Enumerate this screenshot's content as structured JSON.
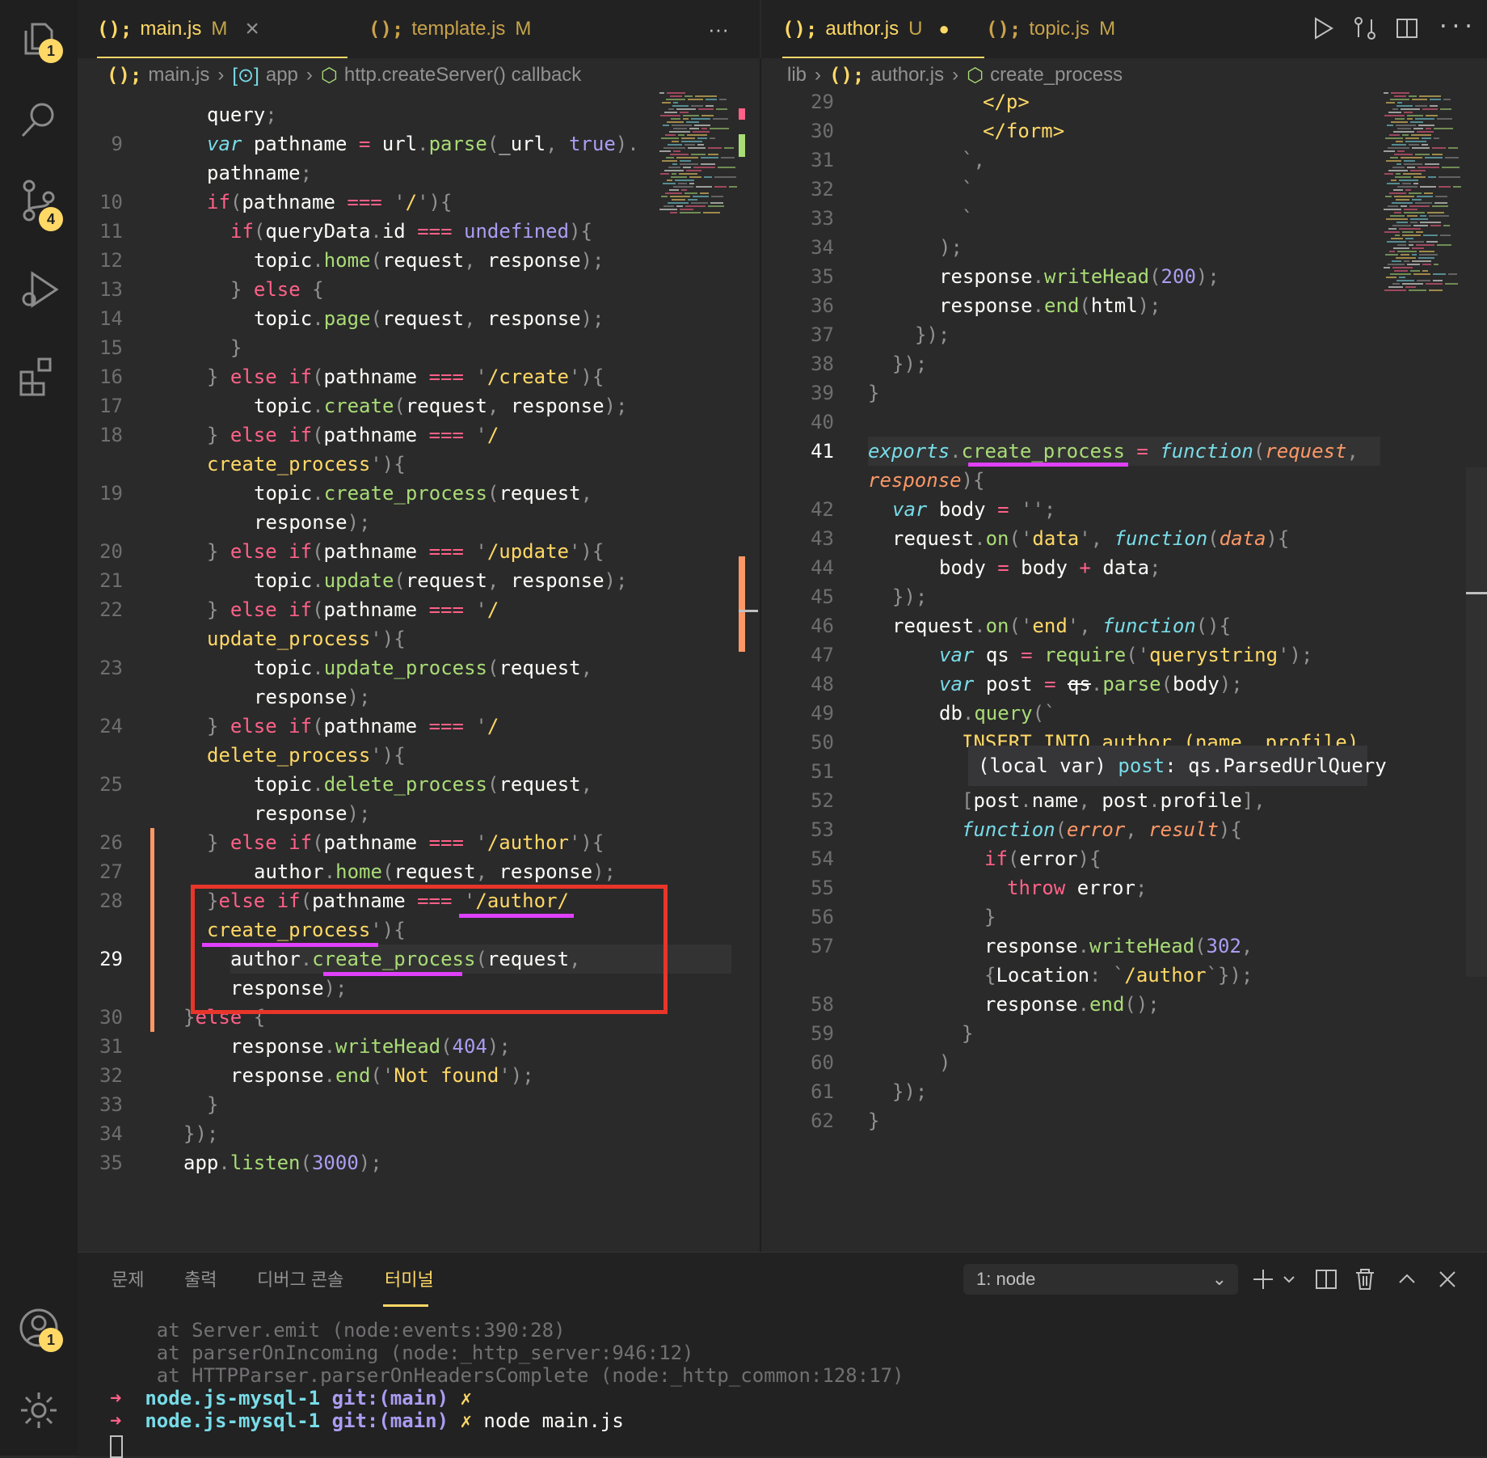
{
  "activity_bar": {
    "explorer_badge": "1",
    "scm_badge": "4",
    "account_badge": "1"
  },
  "left_editor": {
    "tabs": [
      {
        "icon": "(); ",
        "label": "main.js",
        "status": "M"
      },
      {
        "icon": "(); ",
        "label": "template.js",
        "status": "M"
      }
    ],
    "more": "···",
    "breadcrumb": [
      "main.js",
      "app",
      "http.createServer() callback"
    ],
    "gutter": [
      "",
      "9",
      "",
      "10",
      "11",
      "12",
      "13",
      "14",
      "15",
      "16",
      "17",
      "18",
      "",
      "19",
      "",
      "20",
      "21",
      "22",
      "",
      "23",
      "",
      "24",
      "",
      "25",
      "",
      "26",
      "27",
      "28",
      "",
      "29",
      "",
      "30",
      "31",
      "32",
      "33",
      "34",
      "35"
    ]
  },
  "right_editor": {
    "tabs": [
      {
        "icon": "(); ",
        "label": "author.js",
        "status": "U"
      },
      {
        "icon": "(); ",
        "label": "topic.js",
        "status": "M"
      }
    ],
    "breadcrumb": [
      "lib",
      "author.js",
      "create_process"
    ],
    "gutter": [
      "29",
      "30",
      "31",
      "32",
      "33",
      "34",
      "35",
      "36",
      "37",
      "38",
      "39",
      "40",
      "41",
      "",
      "42",
      "43",
      "44",
      "45",
      "46",
      "47",
      "48",
      "49",
      "50",
      "51",
      "52",
      "53",
      "54",
      "55",
      "56",
      "57",
      "",
      "58",
      "59",
      "60",
      "61",
      "62"
    ],
    "hover_tooltip": {
      "prefix": "(local var) ",
      "name": "post",
      "type": ": qs.ParsedUrlQuery"
    }
  },
  "panel": {
    "tabs": [
      "문제",
      "출력",
      "디버그 콘솔",
      "터미널"
    ],
    "active_tab": "터미널",
    "terminal_select": "1: node",
    "terminal_lines": [
      "    at Server.emit (node:events:390:28)",
      "    at parserOnIncoming (node:_http_server:946:12)",
      "    at HTTPParser.parserOnHeadersComplete (node:_http_common:128:17)"
    ],
    "prompts": [
      {
        "arrow": "➜",
        "dir": "node.js-mysql-1",
        "git": "git:(main)",
        "x": "✗",
        "cmd": ""
      },
      {
        "arrow": "➜",
        "dir": "node.js-mysql-1",
        "git": "git:(main)",
        "x": "✗",
        "cmd": "node main.js"
      }
    ]
  },
  "colors": {
    "accent": "#ffd866",
    "highlight_box": "#e8352a",
    "underline": "#e040fb"
  }
}
